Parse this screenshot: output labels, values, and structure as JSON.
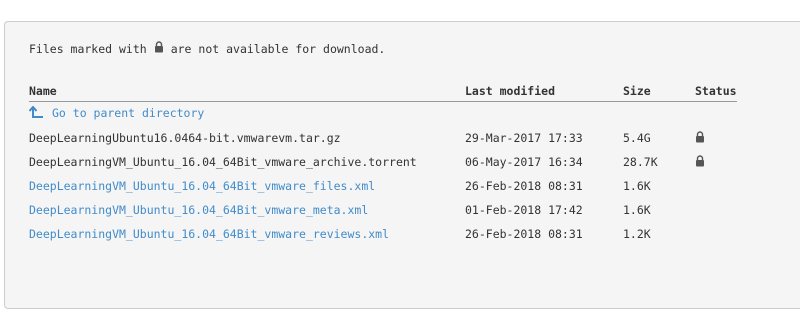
{
  "notice": {
    "before": "Files marked with",
    "after": "are not available for download.",
    "icon": "lock-icon"
  },
  "columns": {
    "name": "Name",
    "last_modified": "Last modified",
    "size": "Size",
    "status": "Status"
  },
  "parent": {
    "label": "Go to parent directory",
    "icon": "up-arrow-icon"
  },
  "files": [
    {
      "name": "DeepLearningUbuntu16.0464-bit.vmwarevm.tar.gz",
      "modified": "29-Mar-2017 17:33",
      "size": "5.4G",
      "locked": true
    },
    {
      "name": "DeepLearningVM_Ubuntu_16.04_64Bit_vmware_archive.torrent",
      "modified": "06-May-2017 16:34",
      "size": "28.7K",
      "locked": true
    },
    {
      "name": "DeepLearningVM_Ubuntu_16.04_64Bit_vmware_files.xml",
      "modified": "26-Feb-2018 08:31",
      "size": "1.6K",
      "locked": false
    },
    {
      "name": "DeepLearningVM_Ubuntu_16.04_64Bit_vmware_meta.xml",
      "modified": "01-Feb-2018 17:42",
      "size": "1.6K",
      "locked": false
    },
    {
      "name": "DeepLearningVM_Ubuntu_16.04_64Bit_vmware_reviews.xml",
      "modified": "26-Feb-2018 08:31",
      "size": "1.2K",
      "locked": false
    }
  ],
  "colors": {
    "link": "#428bca",
    "text": "#333333",
    "panel_bg": "#f5f5f5"
  }
}
